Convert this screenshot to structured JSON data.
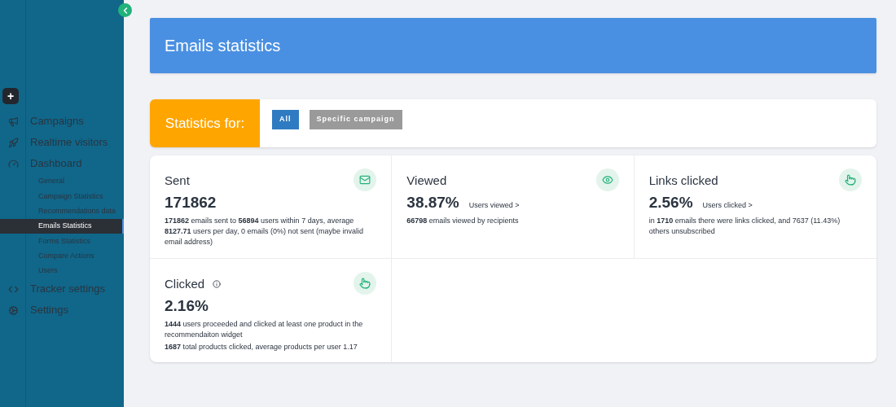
{
  "sidebar": {
    "add_button": "+",
    "items": [
      {
        "label": "Campaigns"
      },
      {
        "label": "Realtime visitors"
      },
      {
        "label": "Dashboard",
        "children": [
          {
            "label": "General",
            "selected": false
          },
          {
            "label": "Campaign Statistics",
            "selected": false
          },
          {
            "label": "Recommendations data",
            "selected": false
          },
          {
            "label": "Emails Statistics",
            "selected": true
          },
          {
            "label": "Forms Statistics",
            "selected": false
          },
          {
            "label": "Compare Actions",
            "selected": false
          },
          {
            "label": "Users",
            "selected": false
          }
        ]
      },
      {
        "label": "Tracker settings"
      },
      {
        "label": "Settings"
      }
    ]
  },
  "header": {
    "title": "Emails statistics"
  },
  "filter": {
    "label": "Statistics for:",
    "options": [
      {
        "label": "All",
        "selected": true
      },
      {
        "label": "Specific campaign",
        "selected": false
      }
    ]
  },
  "stats": [
    {
      "title": "Sent",
      "info": false,
      "value": "171862",
      "description": [
        "**171862** emails sent to **56894** users within 7 days, average **8127.71** users per day, 0 emails (0%) not sent (maybe invalid email address)"
      ]
    },
    {
      "title": "Viewed",
      "info": false,
      "value": "38.87%",
      "link": "Users viewed >",
      "description": [
        "**66798** emails viewed by recipients"
      ]
    },
    {
      "title": "Links clicked",
      "info": false,
      "value": "2.56%",
      "link": "Users clicked >",
      "description": [
        "in **1710** emails there were links clicked, and 7637 (11.43%) others unsubscribed"
      ]
    },
    {
      "title": "Clicked",
      "info": true,
      "value": "2.16%",
      "description": [
        "**1444** users proceeded and clicked at least one product in the recommendaiton widget",
        "**1687** total products clicked, average products per user 1.17"
      ]
    }
  ]
}
